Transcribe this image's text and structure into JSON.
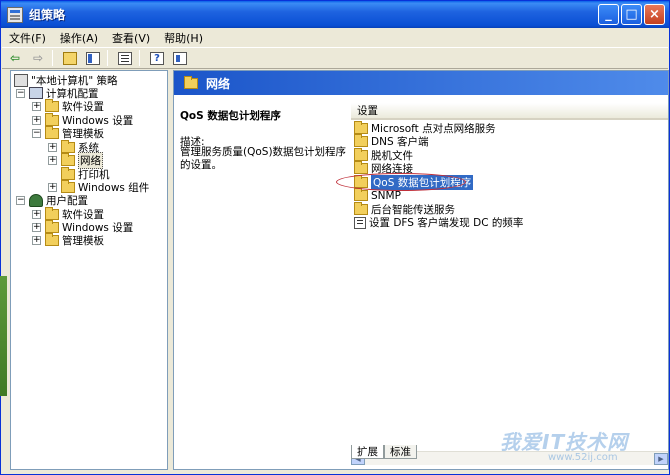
{
  "window": {
    "title": "组策略"
  },
  "menu": [
    {
      "id": "file",
      "label": "文件(F)"
    },
    {
      "id": "action",
      "label": "操作(A)"
    },
    {
      "id": "view",
      "label": "查看(V)"
    },
    {
      "id": "help",
      "label": "帮助(H)"
    }
  ],
  "titlebar_buttons": {
    "minimize": "_",
    "maximize": "□",
    "close": "×"
  },
  "tree": {
    "root": "\"本地计算机\" 策略",
    "computer_config": "计算机配置",
    "software_settings": "软件设置",
    "windows_settings": "Windows 设置",
    "admin_templates": "管理模板",
    "system": "系统",
    "network": "网络",
    "printers": "打印机",
    "windows_components": "Windows 组件",
    "user_config": "用户配置",
    "u_software_settings": "软件设置",
    "u_windows_settings": "Windows 设置",
    "u_admin_templates": "管理模板"
  },
  "right_pane": {
    "header": "网络",
    "desc_title": "QoS 数据包计划程序",
    "desc_label": "描述:",
    "desc_text": "管理服务质量(QoS)数据包计划程序的设置。",
    "column_header": "设置",
    "items": [
      {
        "label": "Microsoft 点对点网络服务",
        "type": "folder"
      },
      {
        "label": "DNS 客户端",
        "type": "folder"
      },
      {
        "label": "脱机文件",
        "type": "folder"
      },
      {
        "label": "网络连接",
        "type": "folder"
      },
      {
        "label": "QoS 数据包计划程序",
        "type": "folder",
        "selected": true
      },
      {
        "label": "SNMP",
        "type": "folder"
      },
      {
        "label": "后台智能传送服务",
        "type": "folder"
      },
      {
        "label": "设置 DFS 客户端发现 DC 的频率",
        "type": "setting"
      }
    ]
  },
  "tabs": {
    "extended": "扩展",
    "standard": "标准"
  },
  "watermark": {
    "text": "我爱IT技术网",
    "sub": "www.52ij.com"
  },
  "colors": {
    "title_bar": "#0a4fd4",
    "selection": "#316ac5",
    "highlight_ellipse": "#c0303a"
  }
}
